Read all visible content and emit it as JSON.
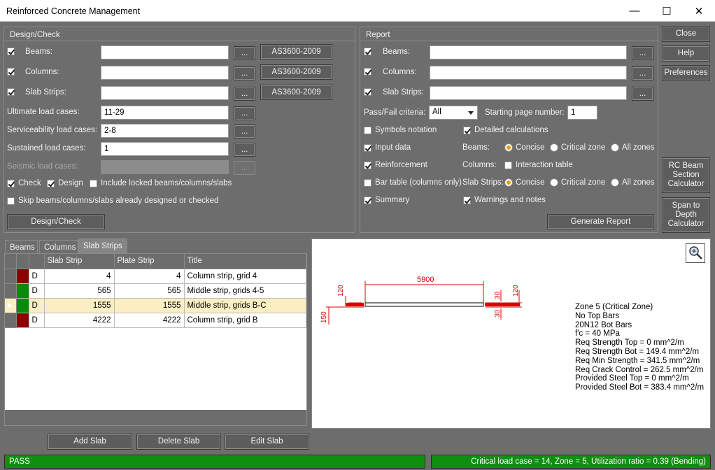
{
  "window": {
    "title": "Reinforced Concrete Management",
    "minimize": "—",
    "maximize": "☐",
    "close": "✕"
  },
  "design": {
    "header": "Design/Check",
    "beams_label": "Beams:",
    "beams_value": "",
    "beams_code": "AS3600-2009",
    "columns_label": "Columns:",
    "columns_value": "",
    "columns_code": "AS3600-2009",
    "slab_label": "Slab Strips:",
    "slab_value": "",
    "slab_code": "AS3600-2009",
    "ult_label": "Ultimate load cases:",
    "ult_value": "11-29",
    "serv_label": "Serviceability load cases:",
    "serv_value": "2-8",
    "sust_label": "Sustained load cases:",
    "sust_value": "1",
    "seis_label": "Seismic load cases:",
    "seis_value": "",
    "check_label": "Check",
    "design_label": "Design",
    "locked_label": "Include locked beams/columns/slabs",
    "skip_label": "Skip beams/columns/slabs already designed or checked",
    "button": "Design/Check",
    "dots": "..."
  },
  "report": {
    "header": "Report",
    "beams_label": "Beams:",
    "columns_label": "Columns:",
    "slab_label": "Slab Strips:",
    "passfail_label": "Pass/Fail criteria:",
    "passfail_value": "All",
    "startpage_label": "Starting page number:",
    "startpage_value": "1",
    "symbols": "Symbols notation",
    "detailed": "Detailed calculations",
    "input": "Input data",
    "reinforcement": "Reinforcement",
    "bartable": "Bar table (columns only)",
    "summary": "Summary",
    "warnings": "Warnings and notes",
    "beams_opt": "Beams:",
    "columns_opt": "Columns:",
    "slab_opt": "Slab Strips:",
    "concise": "Concise",
    "critical": "Critical zone",
    "allzones": "All zones",
    "interaction": "Interaction table",
    "generate": "Generate Report"
  },
  "side": {
    "close": "Close",
    "help": "Help",
    "prefs": "Preferences",
    "rcbeam": "RC Beam Section Calculator",
    "span": "Span to Depth Calculator"
  },
  "tabs": [
    "Beams",
    "Columns",
    "Slab Strips"
  ],
  "grid": {
    "headers": [
      "Slab Strip",
      "Plate Strip",
      "Title"
    ],
    "rows": [
      {
        "flag": "D",
        "slab": "4",
        "plate": "4",
        "title": "Column strip, grid 4",
        "color": "#8b0000"
      },
      {
        "flag": "D",
        "slab": "565",
        "plate": "565",
        "title": "Middle strip, grids 4-5",
        "color": "#0a8a0a"
      },
      {
        "flag": "D",
        "slab": "1555",
        "plate": "1555",
        "title": "Middle strip, grids B-C",
        "color": "#0a8a0a"
      },
      {
        "flag": "D",
        "slab": "4222",
        "plate": "4222",
        "title": "Column strip, grid B",
        "color": "#8b0000"
      }
    ]
  },
  "buttons": {
    "add": "Add Slab",
    "delete": "Delete Slab",
    "edit": "Edit Slab"
  },
  "drawing": {
    "span": "5900",
    "d120a": "120",
    "d150": "150",
    "d30a": "30",
    "d30b": "30",
    "d120b": "120",
    "info": [
      "Zone 5 (Critical Zone)",
      "No Top Bars",
      "20N12 Bot Bars",
      "f'c = 40 MPa",
      "Req Strength Top = 0 mm^2/m",
      "Req Strength Bot = 149.4 mm^2/m",
      "Req Min Strength = 341.5 mm^2/m",
      "Req Crack Control = 262.5 mm^2/m",
      "Provided Steel Top = 0 mm^2/m",
      "Provided Steel Bot = 383.4 mm^2/m"
    ]
  },
  "status": {
    "left": "PASS",
    "right": "Critical load case = 14, Zone = 5, Utilization ratio = 0.39 (Bending)"
  }
}
